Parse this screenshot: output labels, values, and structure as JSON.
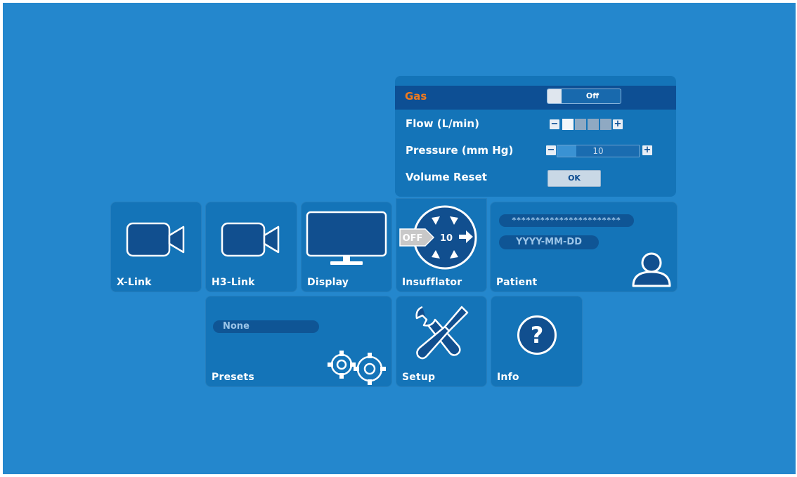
{
  "insufflator_panel": {
    "gas": {
      "label": "Gas",
      "toggle_value": "Off"
    },
    "flow": {
      "label": "Flow (L/min)",
      "minus": "−",
      "plus": "+",
      "level": 1,
      "segments": 4
    },
    "pressure": {
      "label": "Pressure (mm Hg)",
      "minus": "−",
      "plus": "+",
      "value": "10",
      "fraction": 0.23
    },
    "volume_reset": {
      "label": "Volume Reset",
      "button": "OK"
    }
  },
  "tiles": {
    "xlink": {
      "label": "X-Link"
    },
    "h3link": {
      "label": "H3-Link"
    },
    "display": {
      "label": "Display"
    },
    "insufflator": {
      "label": "Insufflator",
      "state": "OFF",
      "setpoint": "10"
    },
    "patient": {
      "label": "Patient",
      "name_mask": "***********************",
      "date_placeholder": "YYYY-MM-DD"
    },
    "presets": {
      "label": "Presets",
      "current": "None"
    },
    "setup": {
      "label": "Setup"
    },
    "info": {
      "label": "Info",
      "icon_glyph": "?"
    }
  },
  "icons": {
    "xlink": "video-camera-icon",
    "h3link": "video-camera-icon",
    "display": "monitor-icon",
    "insufflator": "insufflator-dial-icon",
    "patient": "person-icon",
    "presets": "gears-icon",
    "setup": "wrench-screwdriver-icon",
    "info": "help-icon"
  },
  "colors": {
    "background": "#2487cd",
    "tile": "#1474b8",
    "gas_label": "#f07a1e",
    "gas_row": "#0d4f94"
  }
}
